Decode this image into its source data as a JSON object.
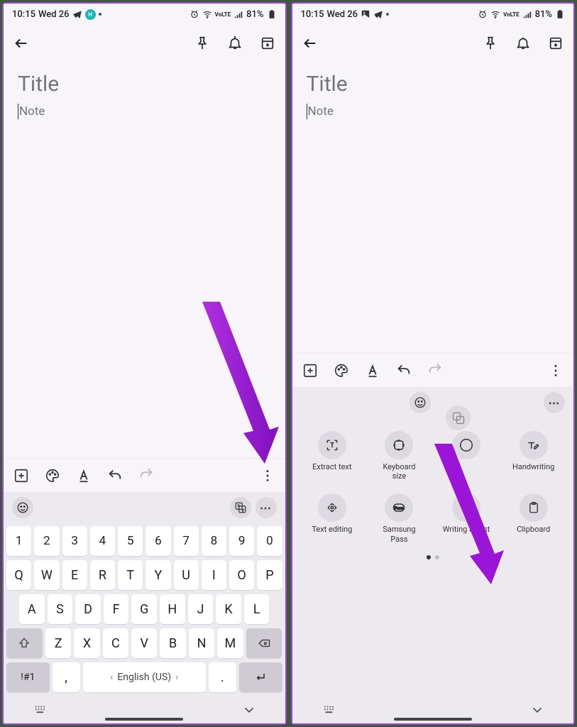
{
  "status": {
    "time": "10:15",
    "day": "Wed 26",
    "battery": "81%",
    "volte": "VoLTE"
  },
  "note": {
    "title_placeholder": "Title",
    "body_placeholder": "Note"
  },
  "keyboard": {
    "numbers": [
      "1",
      "2",
      "3",
      "4",
      "5",
      "6",
      "7",
      "8",
      "9",
      "0"
    ],
    "row1": [
      "Q",
      "W",
      "E",
      "R",
      "T",
      "Y",
      "U",
      "I",
      "O",
      "P"
    ],
    "row2": [
      "A",
      "S",
      "D",
      "F",
      "G",
      "H",
      "J",
      "K",
      "L"
    ],
    "row3": [
      "Z",
      "X",
      "C",
      "V",
      "B",
      "N",
      "M"
    ],
    "sym": "!#1",
    "comma": ",",
    "period": ".",
    "space_label": "English (US)"
  },
  "features": [
    {
      "label": "Extract text"
    },
    {
      "label": "Keyboard size"
    },
    {
      "label": ""
    },
    {
      "label": "Handwriting"
    },
    {
      "label": "Text editing"
    },
    {
      "label": "Samsung Pass"
    },
    {
      "label": "Writing assist"
    },
    {
      "label": "Clipboard"
    }
  ]
}
